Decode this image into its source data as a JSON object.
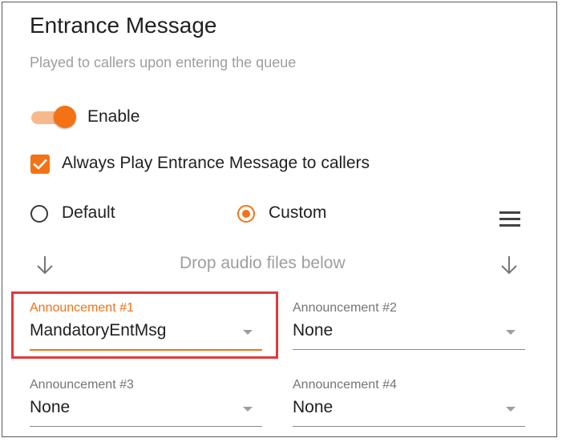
{
  "section": {
    "title": "Entrance Message",
    "subtitle": "Played to callers upon entering the queue"
  },
  "enable_toggle": {
    "label": "Enable",
    "on": true
  },
  "always_play_checkbox": {
    "label": "Always Play Entrance Message to callers",
    "checked": true
  },
  "message_type": {
    "options": [
      {
        "label": "Default",
        "selected": false
      },
      {
        "label": "Custom",
        "selected": true
      }
    ]
  },
  "menu_icon": "menu-icon",
  "drop_zone": {
    "text": "Drop audio files below",
    "icon": "arrow-down-icon"
  },
  "announcements": [
    {
      "label": "Announcement #1",
      "value": "MandatoryEntMsg",
      "highlighted": true
    },
    {
      "label": "Announcement #2",
      "value": "None"
    },
    {
      "label": "Announcement #3",
      "value": "None"
    },
    {
      "label": "Announcement #4",
      "value": "None"
    }
  ],
  "colors": {
    "accent": "#f47216",
    "accent_light": "#f7b98c",
    "highlight_box": "#e0393e",
    "muted_text": "#9e9e9e"
  }
}
